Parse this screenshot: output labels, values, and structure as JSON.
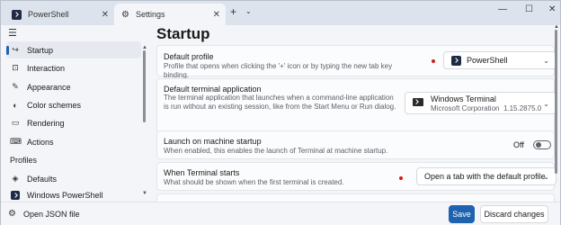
{
  "tabs": [
    {
      "label": "PowerShell",
      "icon": "powershell-icon",
      "active": false
    },
    {
      "label": "Settings",
      "icon": "gear-icon",
      "active": true
    }
  ],
  "window_controls": {
    "minimize": "—",
    "maximize": "☐",
    "close": "✕",
    "new_tab": "+",
    "tab_menu": "⌄",
    "tab_close": "✕"
  },
  "sidebar": {
    "menu_icon": "☰",
    "items": [
      {
        "label": "Startup",
        "icon": "startup-icon",
        "glyph": "↪",
        "active": true
      },
      {
        "label": "Interaction",
        "icon": "interaction-icon",
        "glyph": "⊡"
      },
      {
        "label": "Appearance",
        "icon": "brush-icon",
        "glyph": "✎"
      },
      {
        "label": "Color schemes",
        "icon": "palette-icon",
        "glyph": "◐"
      },
      {
        "label": "Rendering",
        "icon": "monitor-icon",
        "glyph": "▭"
      },
      {
        "label": "Actions",
        "icon": "keyboard-icon",
        "glyph": "⌨"
      }
    ],
    "profiles_label": "Profiles",
    "profiles": [
      {
        "label": "Defaults",
        "icon": "layers-icon",
        "glyph": "◈"
      },
      {
        "label": "Windows PowerShell",
        "icon": "powershell-icon"
      }
    ]
  },
  "main": {
    "title": "Startup",
    "settings": [
      {
        "title": "Default profile",
        "description": "Profile that opens when clicking the '+' icon or by typing the new tab key binding.",
        "value": "PowerShell"
      },
      {
        "title": "Default terminal application",
        "description": "The terminal application that launches when a command-line application is run without an existing session, like from the Start Menu or Run dialog.",
        "value": "Windows Terminal",
        "subvalue_publisher": "Microsoft Corporation",
        "subvalue_version": "1.15.2875.0"
      },
      {
        "title": "Launch on machine startup",
        "description": "When enabled, this enables the launch of Terminal at machine startup.",
        "toggle_label": "Off",
        "toggle_on": false
      },
      {
        "title": "When Terminal starts",
        "description": "What should be shown when the first terminal is created.",
        "value": "Open a tab with the default profile"
      }
    ]
  },
  "bottom": {
    "open_json_label": "Open JSON file",
    "save_label": "Save",
    "discard_label": "Discard changes"
  },
  "colors": {
    "accent": "#1f62b0",
    "unsaved_dot": "#d11a1a"
  }
}
